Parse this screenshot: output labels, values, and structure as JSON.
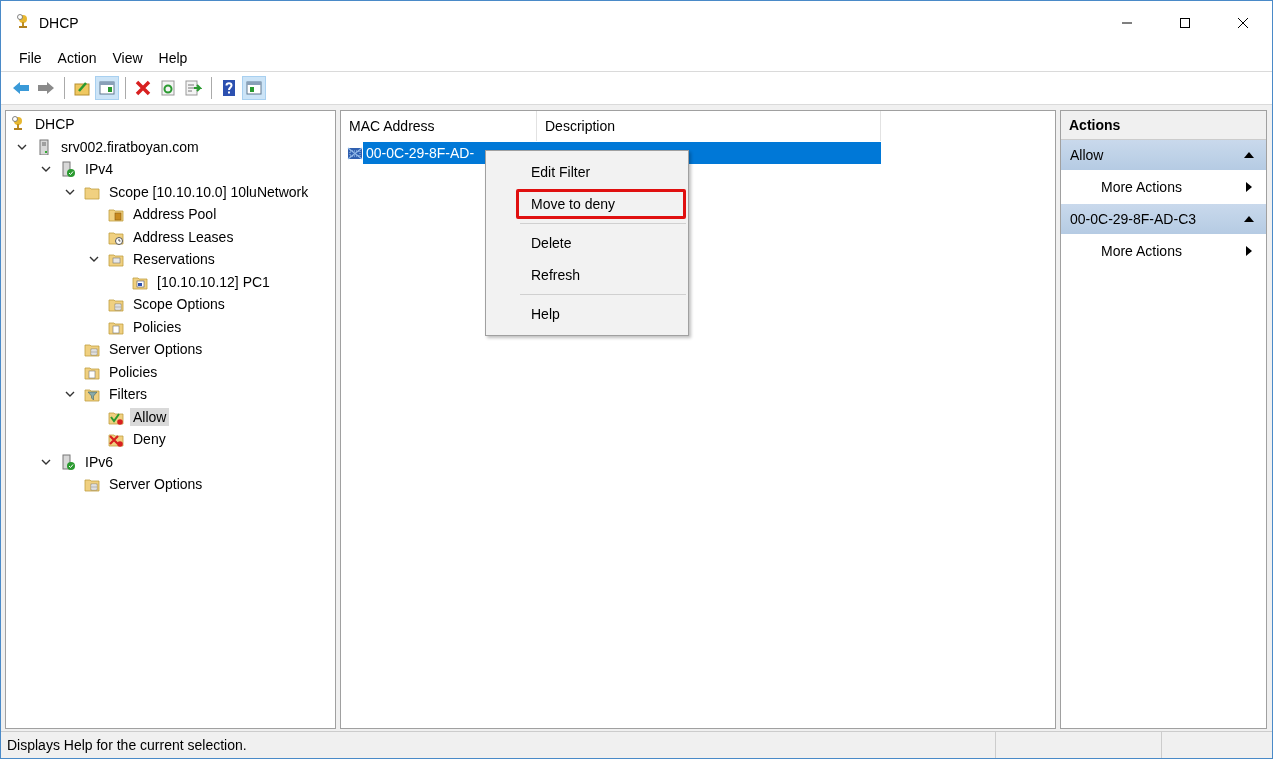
{
  "window": {
    "title": "DHCP",
    "controls": [
      {
        "kind": "minimize"
      },
      {
        "kind": "maximize"
      },
      {
        "kind": "close"
      }
    ]
  },
  "menu_bar": [
    "File",
    "Action",
    "View",
    "Help"
  ],
  "toolbar": [
    {
      "kind": "back",
      "pressed": false
    },
    {
      "kind": "forward",
      "pressed": false
    },
    {
      "kind": "separator"
    },
    {
      "kind": "up",
      "pressed": false
    },
    {
      "kind": "tree",
      "pressed": true
    },
    {
      "kind": "separator"
    },
    {
      "kind": "delete",
      "pressed": false
    },
    {
      "kind": "refresh",
      "pressed": false
    },
    {
      "kind": "export",
      "pressed": false
    },
    {
      "kind": "separator"
    },
    {
      "kind": "help",
      "pressed": false
    },
    {
      "kind": "actions",
      "pressed": true
    }
  ],
  "tree": [
    {
      "label": "DHCP",
      "kind": "root",
      "selected": false,
      "children": [
        {
          "label": "srv002.firatboyan.com",
          "kind": "server",
          "selected": false,
          "expanded": true,
          "children": [
            {
              "label": "IPv4",
              "kind": "ip",
              "selected": false,
              "expanded": true,
              "children": [
                {
                  "label": "Scope [10.10.10.0] 10luNetwork",
                  "kind": "folder",
                  "selected": false,
                  "expanded": true,
                  "children": [
                    {
                      "label": "Address Pool",
                      "kind": "pool",
                      "selected": false
                    },
                    {
                      "label": "Address Leases",
                      "kind": "leases",
                      "selected": false
                    },
                    {
                      "label": "Reservations",
                      "kind": "reservations",
                      "selected": false,
                      "expanded": true,
                      "children": [
                        {
                          "label": "[10.10.10.12] PC1",
                          "kind": "reservation",
                          "selected": false
                        }
                      ]
                    },
                    {
                      "label": "Scope Options",
                      "kind": "options",
                      "selected": false
                    },
                    {
                      "label": "Policies",
                      "kind": "policies",
                      "selected": false
                    }
                  ]
                },
                {
                  "label": "Server Options",
                  "kind": "options",
                  "selected": false
                },
                {
                  "label": "Policies",
                  "kind": "policies",
                  "selected": false
                },
                {
                  "label": "Filters",
                  "kind": "filters",
                  "selected": false,
                  "expanded": true,
                  "children": [
                    {
                      "label": "Allow",
                      "kind": "allow",
                      "selected": true
                    },
                    {
                      "label": "Deny",
                      "kind": "deny",
                      "selected": false
                    }
                  ]
                }
              ]
            },
            {
              "label": "IPv6",
              "kind": "ip",
              "selected": false,
              "expanded": true,
              "children": [
                {
                  "label": "Server Options",
                  "kind": "options",
                  "selected": false
                }
              ]
            }
          ]
        }
      ]
    }
  ],
  "list": {
    "columns": [
      "MAC Address",
      "Description"
    ],
    "rows": [
      {
        "mac": "00-0C-29-8F-AD-",
        "selected": true
      }
    ]
  },
  "context_menu": [
    {
      "kind": "item",
      "label": "Edit Filter",
      "outlined": false
    },
    {
      "kind": "item",
      "label": "Move to deny",
      "outlined": true
    },
    {
      "kind": "separator"
    },
    {
      "kind": "item",
      "label": "Delete",
      "outlined": false
    },
    {
      "kind": "item",
      "label": "Refresh",
      "outlined": false
    },
    {
      "kind": "separator"
    },
    {
      "kind": "item",
      "label": "Help",
      "outlined": false
    }
  ],
  "actions": {
    "title": "Actions",
    "sections": [
      {
        "title": "Allow",
        "expanded": true,
        "items": [
          "More Actions"
        ]
      },
      {
        "title": "00-0C-29-8F-AD-C3",
        "expanded": true,
        "items": [
          "More Actions"
        ]
      }
    ]
  },
  "status_bar": "Displays Help for the current selection."
}
